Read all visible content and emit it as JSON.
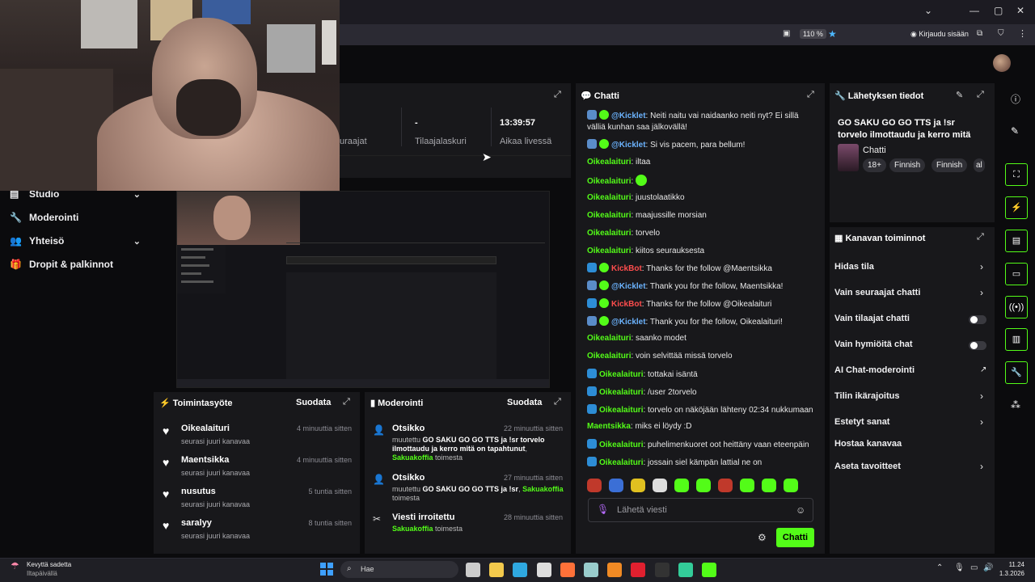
{
  "browser": {
    "zoom": "110 %",
    "login_label": "Kirjaudu sisään"
  },
  "stats": {
    "followers_label": "uraajat",
    "subs_value": "-",
    "subs_label": "Tilaajalaskuri",
    "live_time": "13:39:57",
    "live_label": "Aikaa livessä"
  },
  "nav": {
    "studio": "Studio",
    "moderation": "Moderointi",
    "community": "Yhteisö",
    "drops": "Dropit & palkinnot"
  },
  "chat": {
    "title": "Chatti",
    "input_placeholder": "Lähetä viesti",
    "send_label": "Chatti",
    "messages": [
      {
        "user": "@Kicklet",
        "style": "blue",
        "badges": [
          "bot",
          "ver"
        ],
        "text": ": Neiti naitu vai naidaanko neiti nyt? Ei sillä välliä kunhan saa jälkovällä!"
      },
      {
        "user": "@Kicklet",
        "style": "blue",
        "badges": [
          "bot",
          "ver"
        ],
        "text": ": Si vis pacem, para bellum!"
      },
      {
        "user": "Oikealaituri",
        "style": "green",
        "badges": [],
        "text": ": iltaa"
      },
      {
        "user": "Oikealaituri",
        "style": "green",
        "badges": [],
        "text": ": "
      },
      {
        "user": "Oikealaituri",
        "style": "green",
        "badges": [],
        "text": ": juustolaatikko"
      },
      {
        "user": "Oikealaituri",
        "style": "green",
        "badges": [],
        "text": ": maajussille morsian"
      },
      {
        "user": "Oikealaituri",
        "style": "green",
        "badges": [],
        "text": ": torvelo"
      },
      {
        "user": "Oikealaituri",
        "style": "green",
        "badges": [],
        "text": ": kiitos seurauksesta"
      },
      {
        "user": "KickBot",
        "style": "red",
        "badges": [
          "mod",
          "ver"
        ],
        "text": ": Thanks for the follow @Maentsikka"
      },
      {
        "user": "@Kicklet",
        "style": "blue",
        "badges": [
          "bot",
          "ver"
        ],
        "text": ": Thank you for the follow, Maentsikka!"
      },
      {
        "user": "KickBot",
        "style": "red",
        "badges": [
          "mod",
          "ver"
        ],
        "text": ": Thanks for the follow @Oikealaituri"
      },
      {
        "user": "@Kicklet",
        "style": "blue",
        "badges": [
          "bot",
          "ver"
        ],
        "text": ": Thank you for the follow, Oikealaituri!"
      },
      {
        "user": "Oikealaituri",
        "style": "green",
        "badges": [],
        "text": ": saanko modet"
      },
      {
        "user": "Oikealaituri",
        "style": "green",
        "badges": [],
        "text": ": voin selvittää missä torvelo"
      },
      {
        "user": "Oikealaituri",
        "style": "green",
        "badges": [
          "mod"
        ],
        "text": ": tottakai isäntä"
      },
      {
        "user": "Oikealaituri",
        "style": "green",
        "badges": [
          "mod"
        ],
        "text": ": /user 2torvelo"
      },
      {
        "user": "Oikealaituri",
        "style": "green",
        "badges": [
          "mod"
        ],
        "text": ": torvelo on näköjään lähteny 02:34 nukkumaan"
      },
      {
        "user": "Maentsikka",
        "style": "green",
        "badges": [],
        "text": ": miks ei löydy :D"
      },
      {
        "user": "Oikealaituri",
        "style": "green",
        "badges": [
          "mod"
        ],
        "text": ": puhelimenkuoret oot heittäny vaan eteenpäin"
      },
      {
        "user": "Oikealaituri",
        "style": "green",
        "badges": [
          "mod"
        ],
        "text": ": jossain siel kämpän lattial ne on"
      }
    ]
  },
  "stream_info": {
    "title": "Lähetyksen tiedot",
    "stream_title": "GO SAKU GO GO TTS ja !sr torvelo ilmottaudu ja kerro mitä on...",
    "category": "Chatti",
    "tags": [
      "18+",
      "Finnish",
      "Finnish",
      "al"
    ]
  },
  "channel_actions": {
    "title": "Kanavan toiminnot",
    "items": [
      {
        "label": "Hidas tila",
        "control": "chevron"
      },
      {
        "label": "Vain seuraajat chatti",
        "control": "chevron"
      },
      {
        "label": "Vain tilaajat chatti",
        "control": "toggle"
      },
      {
        "label": "Vain hymiöitä chat",
        "control": "toggle"
      },
      {
        "label": "AI Chat-moderointi",
        "control": "external"
      },
      {
        "label": "Tilin ikärajoitus",
        "control": "chevron"
      },
      {
        "label": "Estetyt sanat",
        "control": "chevron"
      },
      {
        "label": "Hostaa kanavaa",
        "control": "none"
      },
      {
        "label": "Aseta tavoitteet",
        "control": "chevron"
      }
    ]
  },
  "activity": {
    "title": "Toimintasyöte",
    "filter_label": "Suodata",
    "items": [
      {
        "name": "Oikealaituri",
        "sub": "seurasi juuri kanavaa",
        "time": "4 minuuttia sitten"
      },
      {
        "name": "Maentsikka",
        "sub": "seurasi juuri kanavaa",
        "time": "4 minuuttia sitten"
      },
      {
        "name": "nusutus",
        "sub": "seurasi juuri kanavaa",
        "time": "5 tuntia sitten"
      },
      {
        "name": "saralyy",
        "sub": "seurasi juuri kanavaa",
        "time": "8 tuntia sitten"
      }
    ]
  },
  "moderation": {
    "title": "Moderointi",
    "filter_label": "Suodata",
    "items": [
      {
        "name": "Otsikko",
        "prefix": "muutettu ",
        "bold": "GO SAKU GO GO TTS ja !sr torvelo ilmottaudu ja kerro mitä on tapahtunut",
        "sep": ", ",
        "actor": "Sakuakoffia",
        "suffix": " toimesta",
        "time": "22 minuuttia sitten"
      },
      {
        "name": "Otsikko",
        "prefix": "muutettu ",
        "bold": "GO SAKU GO GO TTS ja !sr",
        "sep": ", ",
        "actor": "Sakuakoffia",
        "suffix": " toimesta",
        "time": "27 minuuttia sitten"
      },
      {
        "name": "Viesti irroitettu",
        "prefix": "",
        "bold": "",
        "sep": "",
        "actor": "Sakuakoffia",
        "suffix": " toimesta",
        "time": "28 minuuttia sitten"
      }
    ]
  },
  "taskbar": {
    "weather_title": "Kevyttä sadetta",
    "weather_sub": "Iltapäivällä",
    "search_placeholder": "Hae",
    "time": "11.24",
    "date": "1.3.2026"
  },
  "colors": {
    "accent": "#53fc18",
    "panel": "#18181b",
    "background": "#0b0b0d"
  }
}
